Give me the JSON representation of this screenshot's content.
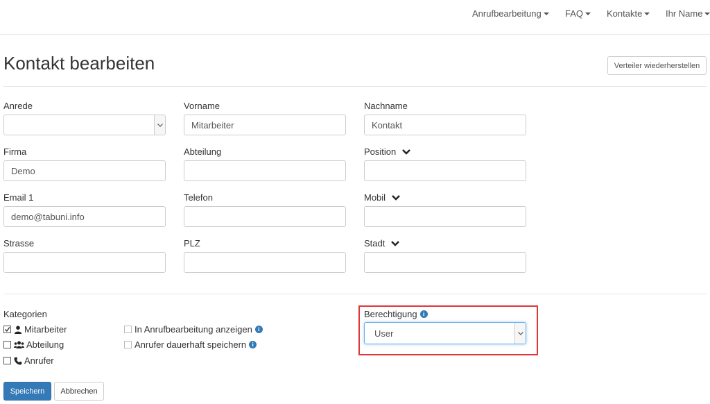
{
  "navbar": {
    "items": [
      {
        "label": "Anrufbearbeitung"
      },
      {
        "label": "FAQ"
      },
      {
        "label": "Kontakte"
      },
      {
        "label": "Ihr Name"
      }
    ]
  },
  "page": {
    "title": "Kontakt bearbeiten",
    "restore_button": "Verteiler wiederherstellen"
  },
  "form": {
    "anrede": {
      "label": "Anrede",
      "value": ""
    },
    "vorname": {
      "label": "Vorname",
      "value": "Mitarbeiter"
    },
    "nachname": {
      "label": "Nachname",
      "value": "Kontakt"
    },
    "firma": {
      "label": "Firma",
      "value": "Demo"
    },
    "abteilung": {
      "label": "Abteilung",
      "value": ""
    },
    "position": {
      "label": "Position",
      "value": ""
    },
    "email": {
      "label": "Email 1",
      "value": "demo@tabuni.info"
    },
    "telefon": {
      "label": "Telefon",
      "value": ""
    },
    "mobil": {
      "label": "Mobil",
      "value": ""
    },
    "strasse": {
      "label": "Strasse",
      "value": ""
    },
    "plz": {
      "label": "PLZ",
      "value": ""
    },
    "stadt": {
      "label": "Stadt",
      "value": ""
    }
  },
  "categories": {
    "label": "Kategorien",
    "items": [
      {
        "label": "Mitarbeiter",
        "checked": true,
        "icon": "user-icon"
      },
      {
        "label": "Abteilung",
        "checked": false,
        "icon": "users-icon"
      },
      {
        "label": "Anrufer",
        "checked": false,
        "icon": "phone-icon"
      }
    ],
    "options": [
      {
        "label": "In Anrufbearbeitung anzeigen",
        "checked": false
      },
      {
        "label": "Anrufer dauerhaft speichern",
        "checked": false
      }
    ]
  },
  "permission": {
    "label": "Berechtigung",
    "value": "User",
    "highlight_color": "#e0373a"
  },
  "actions": {
    "save": "Speichern",
    "cancel": "Abbrechen"
  },
  "colors": {
    "primary": "#337ab7",
    "info": "#337ab7"
  }
}
